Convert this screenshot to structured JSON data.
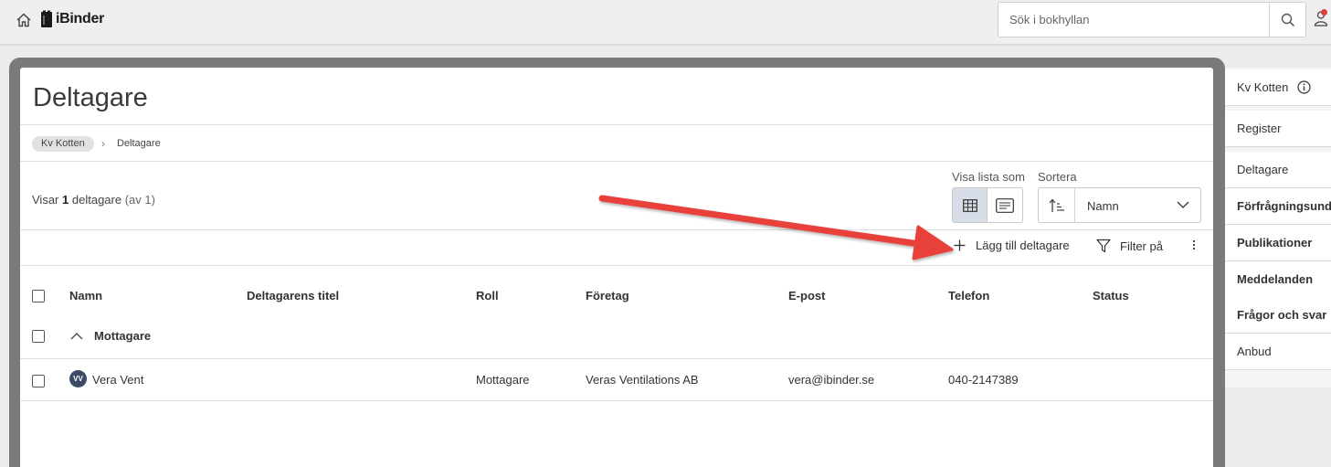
{
  "app": {
    "name": "iBinder"
  },
  "search": {
    "placeholder": "Sök i bokhyllan"
  },
  "page": {
    "title": "Deltagare"
  },
  "breadcrumb": {
    "root": "Kv Kotten",
    "current": "Deltagare"
  },
  "summary": {
    "prefix": "Visar",
    "count": "1",
    "noun": "deltagare",
    "total": "(av 1)"
  },
  "view": {
    "label": "Visa lista som",
    "active": "table"
  },
  "sort": {
    "label": "Sortera",
    "value": "Namn"
  },
  "actions": {
    "add": "Lägg till deltagare",
    "filter": "Filter på"
  },
  "table": {
    "headers": [
      "Namn",
      "Deltagarens titel",
      "Roll",
      "Företag",
      "E-post",
      "Telefon",
      "Status"
    ],
    "group": "Mottagare",
    "rows": [
      {
        "initials": "VV",
        "name": "Vera Vent",
        "title": "",
        "role": "Mottagare",
        "company": "Veras Ventilations AB",
        "email": "vera@ibinder.se",
        "phone": "040-2147389",
        "status": ""
      }
    ]
  },
  "side_nav": {
    "project": "Kv Kotten",
    "items": [
      "Register",
      "Deltagare",
      "Förfrågningsunderlag",
      "Publikationer",
      "Meddelanden",
      "Frågor och svar",
      "Anbud"
    ]
  },
  "colors": {
    "arrow": "#e8403a",
    "avatar": "#3b4b63",
    "notification": "#d9413c",
    "active_toggle": "#d7dde6"
  }
}
